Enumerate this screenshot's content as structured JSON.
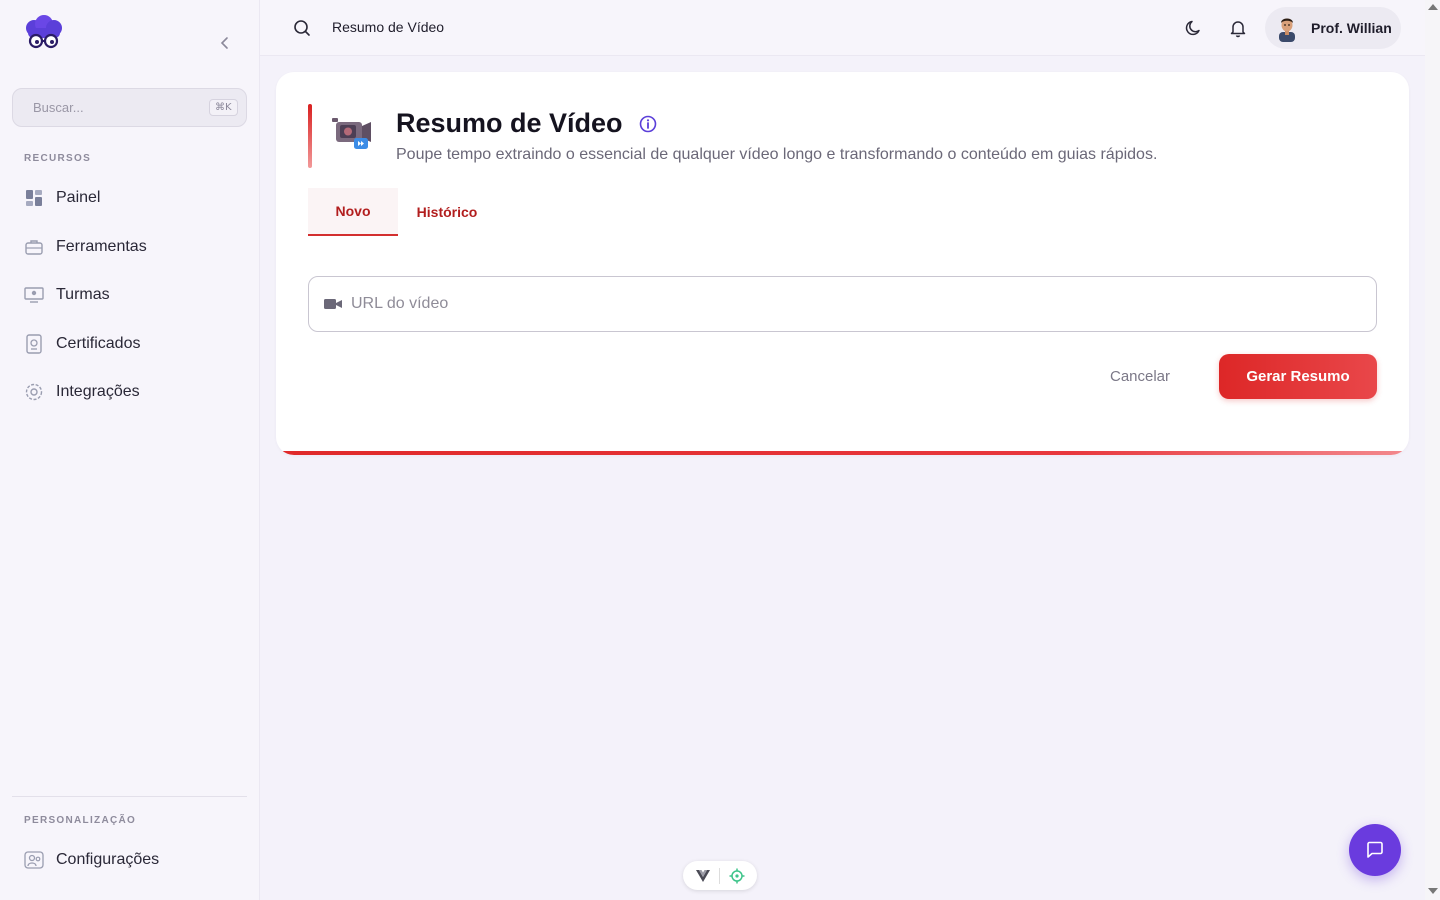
{
  "sidebar": {
    "search": {
      "placeholder": "Buscar...",
      "shortcut": "⌘K"
    },
    "sections": [
      {
        "label": "RECURSOS",
        "items": [
          {
            "label": "Painel",
            "icon": "dashboard-icon"
          },
          {
            "label": "Ferramentas",
            "icon": "toolbox-icon"
          },
          {
            "label": "Turmas",
            "icon": "classroom-icon"
          },
          {
            "label": "Certificados",
            "icon": "certificate-icon"
          },
          {
            "label": "Integrações",
            "icon": "gear-icon"
          }
        ]
      },
      {
        "label": "PERSONALIZAÇÃO",
        "items": [
          {
            "label": "Configurações",
            "icon": "settings-users-icon"
          }
        ]
      }
    ]
  },
  "topbar": {
    "title": "Resumo de Vídeo",
    "user": {
      "name": "Prof. Willian"
    }
  },
  "card": {
    "title": "Resumo de Vídeo",
    "subtitle": "Poupe tempo extraindo o essencial de qualquer vídeo longo e transformando o conteúdo em guias rápidos.",
    "tabs": [
      {
        "label": "Novo",
        "active": true
      },
      {
        "label": "Histórico",
        "active": false
      }
    ],
    "url_field": {
      "placeholder": "URL do vídeo",
      "value": ""
    },
    "cancel_label": "Cancelar",
    "submit_label": "Gerar Resumo"
  },
  "colors": {
    "accent_red": "#dd2727",
    "brand_purple": "#6a3bde",
    "background": "#f4f2fa"
  }
}
